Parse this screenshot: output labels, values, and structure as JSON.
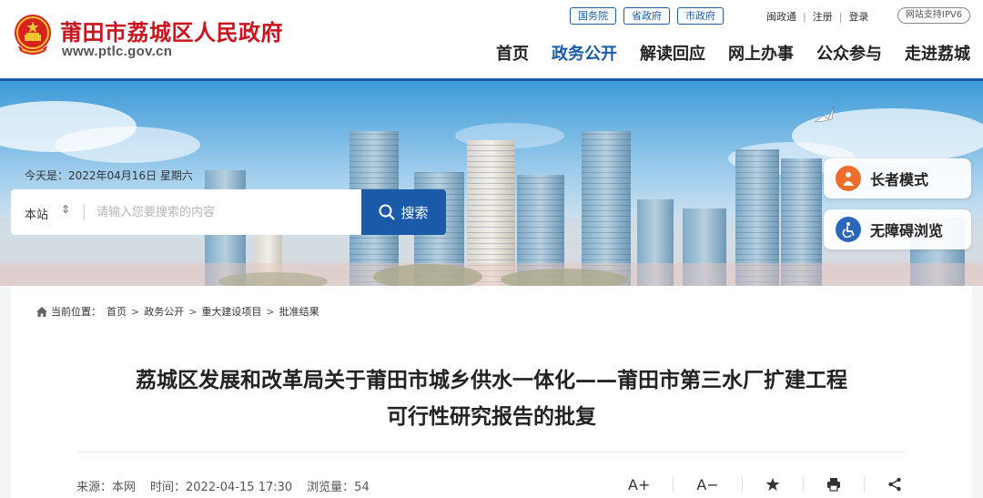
{
  "header": {
    "site_name": "莆田市荔城区人民政府",
    "site_url": "www.ptlc.gov.cn",
    "gov_links": [
      "国务院",
      "省政府",
      "市政府"
    ],
    "utility_links": [
      "闽政通",
      "注册",
      "登录"
    ],
    "ipv6_badge": "网站支持IPV6",
    "nav": [
      {
        "label": "首页",
        "active": false
      },
      {
        "label": "政务公开",
        "active": true
      },
      {
        "label": "解读回应",
        "active": false
      },
      {
        "label": "网上办事",
        "active": false
      },
      {
        "label": "公众参与",
        "active": false
      },
      {
        "label": "走进荔城",
        "active": false
      }
    ],
    "accent_color": "#1a5aa8",
    "brand_color": "#c9151e"
  },
  "banner": {
    "date_text": "今天是：2022年04月16日 星期六",
    "search": {
      "scope": "本站",
      "placeholder": "请输入您要搜索的内容",
      "button_label": "搜索",
      "icon": "search-icon"
    },
    "modes": [
      {
        "label": "长者模式",
        "icon": "elder-icon",
        "color": "#ee6c2c"
      },
      {
        "label": "无障碍浏览",
        "icon": "wheelchair-icon",
        "color": "#2b66b8"
      }
    ]
  },
  "breadcrumb": {
    "prefix": "当前位置：",
    "items": [
      "首页",
      "政务公开",
      "重大建设项目",
      "批准结果"
    ]
  },
  "article": {
    "title_line1": "荔城区发展和改革局关于莆田市城乡供水一体化——莆田市第三水厂扩建工程",
    "title_line2": "可行性研究报告的批复",
    "meta": {
      "source": "来源：本网",
      "time": "时间：2022-04-15 17:30",
      "views": "浏览量：54"
    },
    "tools": [
      "A+",
      "A−"
    ]
  }
}
